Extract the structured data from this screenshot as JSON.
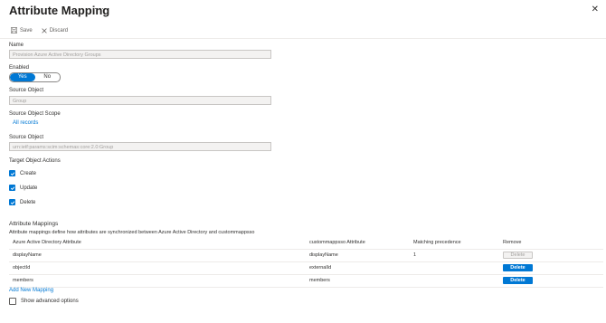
{
  "header": {
    "title": "Attribute Mapping",
    "more": "···",
    "close": "✕"
  },
  "toolbar": {
    "save_label": "Save",
    "discard_label": "Discard"
  },
  "form": {
    "name_label": "Name",
    "name_value": "Provision Azure Active Directory Groups",
    "enabled_label": "Enabled",
    "enabled_yes": "Yes",
    "enabled_no": "No",
    "enabled_selected": "Yes",
    "source_object_label": "Source Object",
    "source_object_value": "Group",
    "scope_label": "Source Object Scope",
    "scope_link": "All records",
    "source_object2_label": "Source Object",
    "source_object2_value": "urn:ietf:params:scim:schemas:core:2.0:Group",
    "target_actions_label": "Target Object Actions",
    "actions": [
      {
        "label": "Create",
        "checked": true
      },
      {
        "label": "Update",
        "checked": true
      },
      {
        "label": "Delete",
        "checked": true
      }
    ]
  },
  "mappings": {
    "title": "Attribute Mappings",
    "description": "Attribute mappings define how attributes are synchronized between Azure Active Directory and custommappsso",
    "columns": [
      "Azure Active Directory Attribute",
      "custommappsso Attribute",
      "Matching precedence",
      "Remove"
    ],
    "rows": [
      {
        "source": "displayName",
        "target": "displayName",
        "precedence": "1",
        "remove": "Delete",
        "remove_enabled": false
      },
      {
        "source": "objectId",
        "target": "externalId",
        "precedence": "",
        "remove": "Delete",
        "remove_enabled": true
      },
      {
        "source": "members",
        "target": "members",
        "precedence": "",
        "remove": "Delete",
        "remove_enabled": true
      }
    ],
    "add_link": "Add New Mapping",
    "advanced_label": "Show advanced options"
  },
  "colors": {
    "accent": "#0078d4",
    "text": "#323130",
    "disabled_bg": "#f3f2f1"
  }
}
